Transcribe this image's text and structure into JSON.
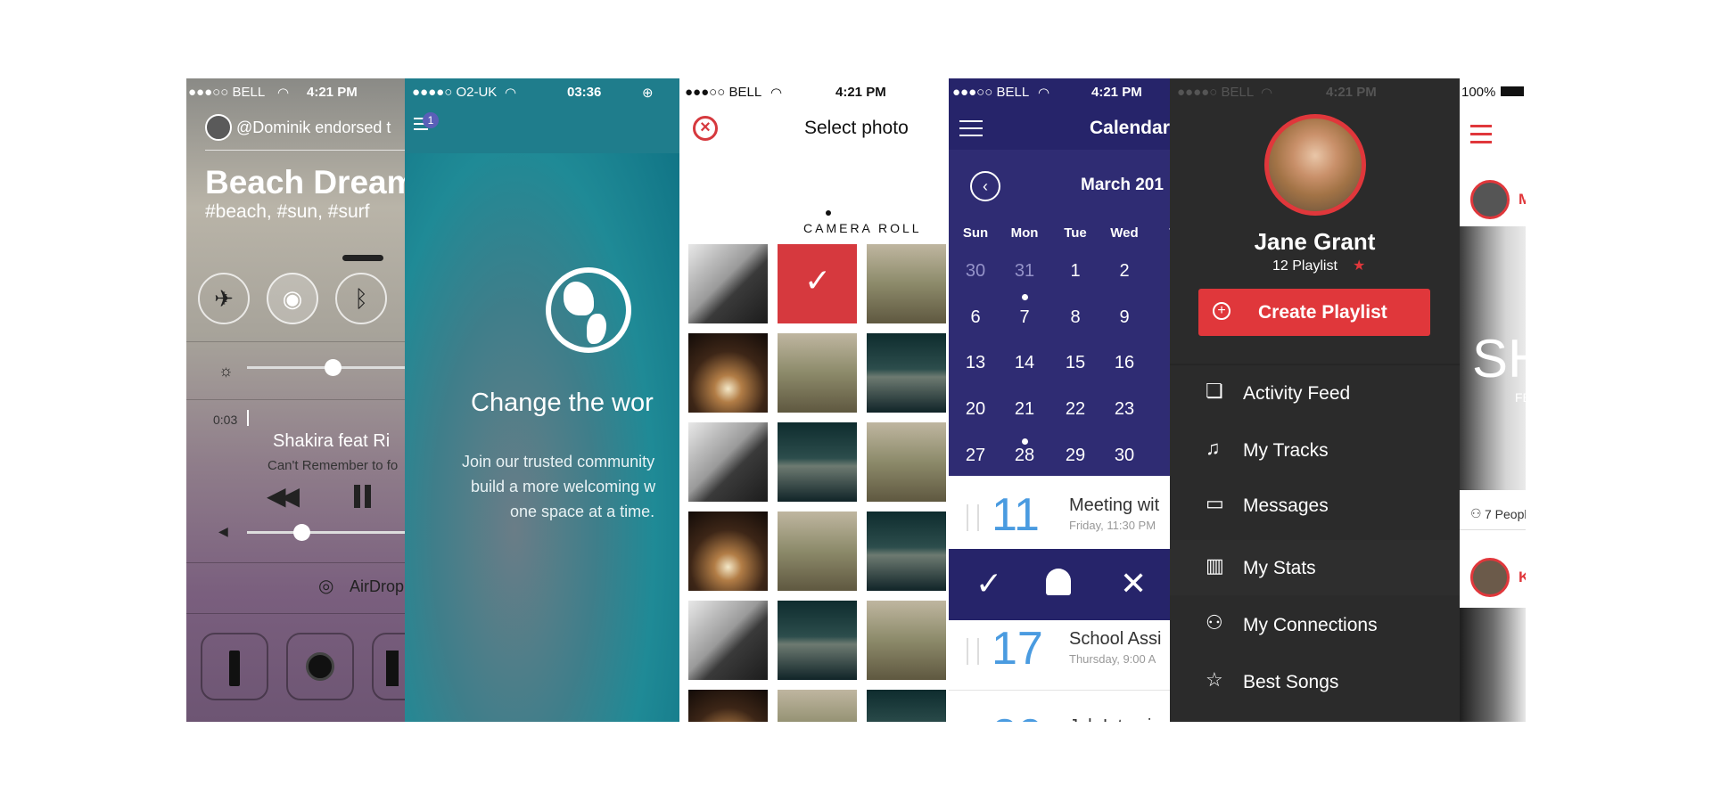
{
  "panel_control_center": {
    "status": {
      "carrier": "●●●○○ BELL",
      "time": "4:21 PM"
    },
    "notification": "@Dominik endorsed t",
    "song_title": "Beach Dream",
    "hashtags": "#beach, #sun, #surf",
    "elapsed": "0:03",
    "track_artist": "Shakira feat Ri",
    "track_song": "Can't Remember to fo",
    "airdrop": "AirDrop",
    "brightness_level": 0.55,
    "volume_level": 0.35
  },
  "panel_onboarding": {
    "status": {
      "carrier": "●●●●○ O2-UK",
      "time": "03:36"
    },
    "badge": "1",
    "headline": "Change the wor",
    "body_lines": [
      "Join our trusted community",
      "build a more welcoming w",
      "one space at a time."
    ]
  },
  "panel_select_photo": {
    "status": {
      "carrier": "●●●○○ BELL",
      "time": "4:21 PM"
    },
    "title": "Select photo",
    "section": "CAMERA ROLL",
    "grid": [
      [
        "a",
        "sel",
        "b"
      ],
      [
        "c",
        "b",
        "d"
      ],
      [
        "a",
        "d",
        "b"
      ],
      [
        "c",
        "b",
        "d"
      ],
      [
        "a",
        "d",
        "b"
      ],
      [
        "c",
        "b",
        "d"
      ]
    ]
  },
  "panel_calendar": {
    "status": {
      "carrier": "●●●○○ BELL",
      "time": "4:21 PM"
    },
    "title": "Calendar",
    "month": "March 201",
    "weekdays": [
      "Sun",
      "Mon",
      "Tue",
      "Wed",
      "T"
    ],
    "weeks": [
      [
        "30",
        "31",
        "1",
        "2"
      ],
      [
        "6",
        "7",
        "8",
        "9"
      ],
      [
        "13",
        "14",
        "15",
        "16"
      ],
      [
        "20",
        "21",
        "22",
        "23"
      ],
      [
        "27",
        "28",
        "29",
        "30"
      ]
    ],
    "events": [
      {
        "day": "11",
        "title": "Meeting wit",
        "time": "Friday, 11:30 PM"
      },
      {
        "day": "17",
        "title": "School Assi",
        "time": "Thursday, 9:00 A"
      },
      {
        "day": "20",
        "title": "Job Intervie",
        "time": ""
      }
    ],
    "colors": {
      "header": "#26246a",
      "grid": "#2f2c73",
      "accent": "#4a9be0"
    }
  },
  "panel_playlist": {
    "status": {
      "carrier": "●●●●○ BELL",
      "time": "4:21 PM"
    },
    "name": "Jane Grant",
    "playlist_count": "12 Playlist",
    "create_button": "Create Playlist",
    "menu": [
      {
        "label": "Activity Feed",
        "icon": "activity-feed-icon"
      },
      {
        "label": "My Tracks",
        "icon": "music-note-icon"
      },
      {
        "label": "Messages",
        "icon": "message-icon"
      },
      {
        "label": "My Stats",
        "icon": "stats-icon"
      },
      {
        "label": "My Connections",
        "icon": "person-icon"
      },
      {
        "label": "Best Songs",
        "icon": "star-icon"
      }
    ],
    "colors": {
      "accent": "#e0373b",
      "bg": "#2b2b2b"
    }
  },
  "panel_feed": {
    "status": {
      "battery": "100%"
    },
    "first_user": "M",
    "people": "7 Peopl",
    "second_user": "Ke",
    "hero_text": "SH",
    "hero_sub": "FE"
  }
}
